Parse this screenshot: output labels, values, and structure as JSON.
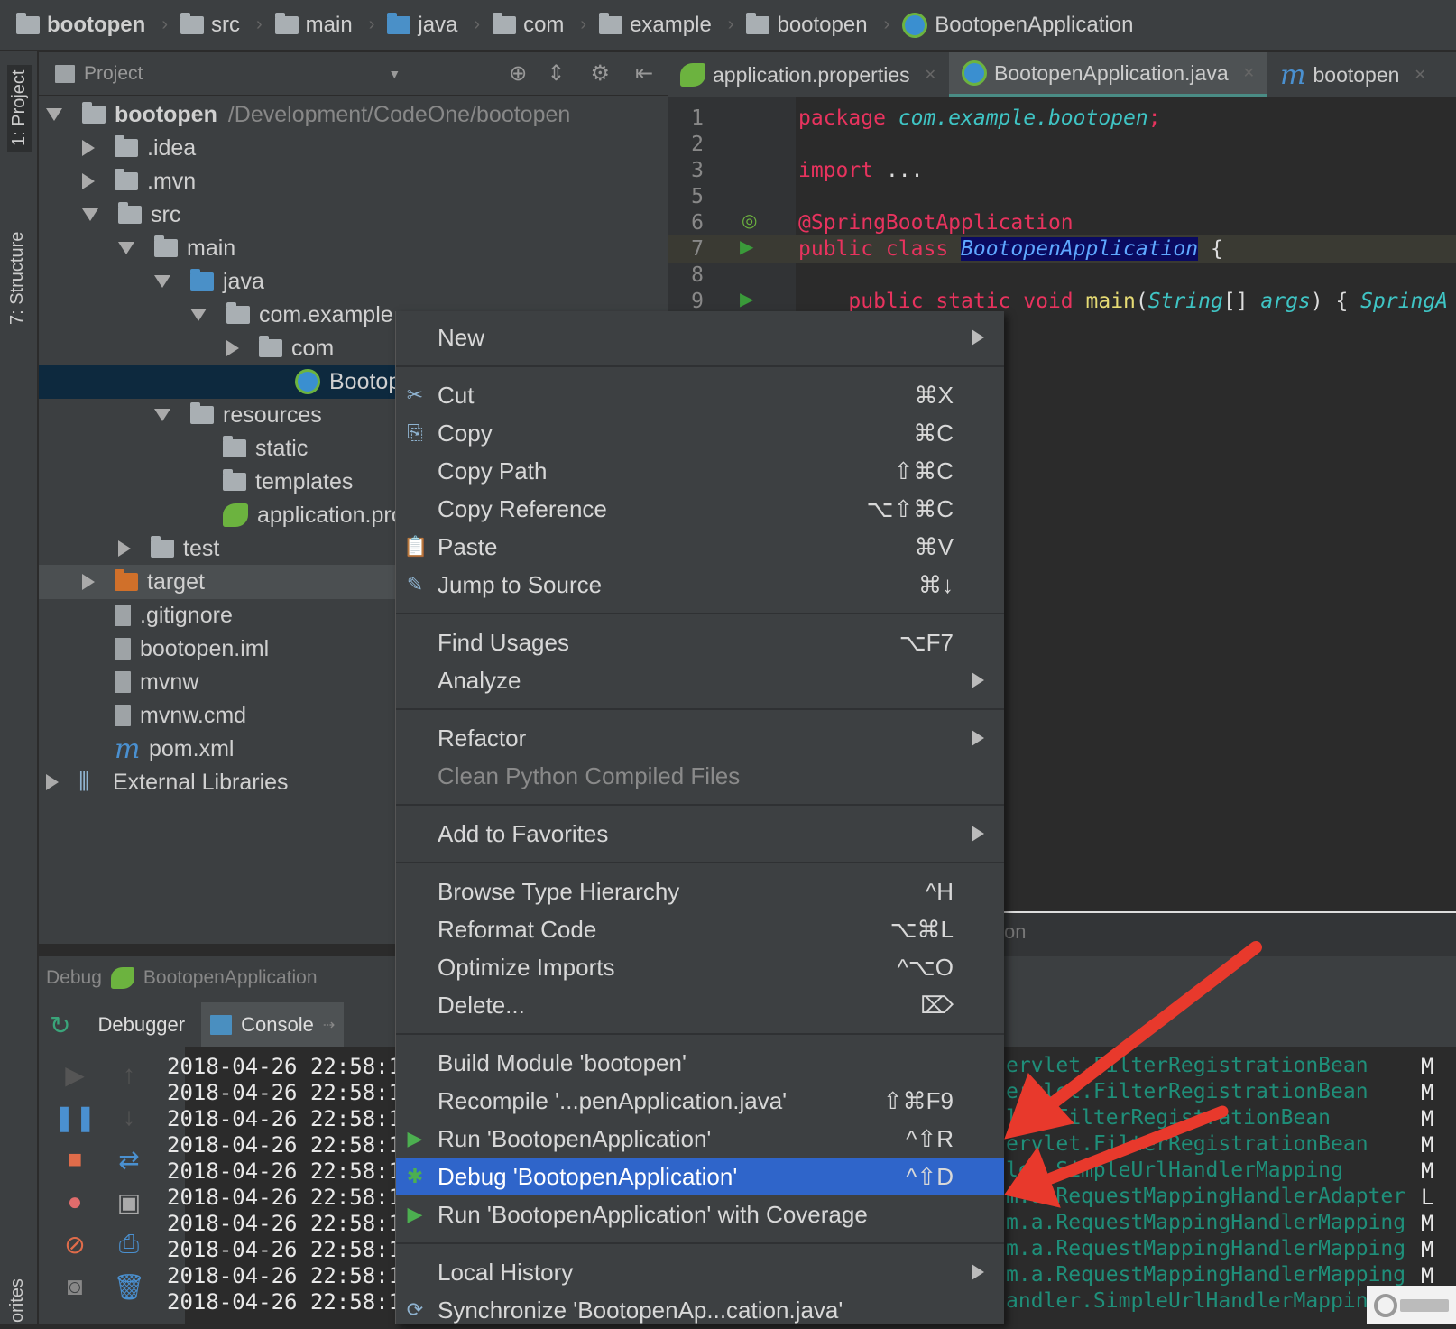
{
  "breadcrumb": [
    "bootopen",
    "src",
    "main",
    "java",
    "com",
    "example",
    "bootopen",
    "BootopenApplication"
  ],
  "toolstrip": {
    "project": "1: Project",
    "structure": "7: Structure",
    "favorites": "orites"
  },
  "project_panel": {
    "title": "Project"
  },
  "tree": [
    {
      "label": "bootopen",
      "path": "/Development/CodeOne/bootopen",
      "level": 0,
      "arrow": "open",
      "icon": "module-folder-icon"
    },
    {
      "label": ".idea",
      "level": 1,
      "arrow": "closed",
      "icon": "folder-icon"
    },
    {
      "label": ".mvn",
      "level": 1,
      "arrow": "closed",
      "icon": "folder-icon"
    },
    {
      "label": "src",
      "level": 1,
      "arrow": "open",
      "icon": "folder-icon"
    },
    {
      "label": "main",
      "level": 2,
      "arrow": "open",
      "icon": "folder-icon"
    },
    {
      "label": "java",
      "level": 3,
      "arrow": "open",
      "icon": "source-folder-icon"
    },
    {
      "label": "com.example",
      "level": 4,
      "arrow": "open",
      "icon": "package-icon"
    },
    {
      "label": "com",
      "level": 5,
      "arrow": "closed",
      "icon": "package-icon"
    },
    {
      "label": "BootopenApplication",
      "level": 6,
      "arrow": "none",
      "icon": "spring-boot-class-icon",
      "state": "selected"
    },
    {
      "label": "resources",
      "level": 3,
      "arrow": "open",
      "icon": "resources-folder-icon"
    },
    {
      "label": "static",
      "level": 4,
      "arrow": "none",
      "icon": "folder-icon"
    },
    {
      "label": "templates",
      "level": 4,
      "arrow": "none",
      "icon": "folder-icon"
    },
    {
      "label": "application.properties",
      "level": 4,
      "arrow": "none",
      "icon": "spring-properties-icon"
    },
    {
      "label": "test",
      "level": 2,
      "arrow": "closed",
      "icon": "folder-icon"
    },
    {
      "label": "target",
      "level": 1,
      "arrow": "closed",
      "icon": "excluded-folder-icon",
      "state": "hover"
    },
    {
      "label": ".gitignore",
      "level": 1,
      "arrow": "none",
      "icon": "file-icon"
    },
    {
      "label": "bootopen.iml",
      "level": 1,
      "arrow": "none",
      "icon": "iml-file-icon"
    },
    {
      "label": "mvnw",
      "level": 1,
      "arrow": "none",
      "icon": "file-icon"
    },
    {
      "label": "mvnw.cmd",
      "level": 1,
      "arrow": "none",
      "icon": "file-icon"
    },
    {
      "label": "pom.xml",
      "level": 1,
      "arrow": "none",
      "icon": "maven-icon"
    },
    {
      "label": "External Libraries",
      "level": 0,
      "arrow": "closed",
      "icon": "libraries-icon"
    }
  ],
  "editor": {
    "tabs": [
      {
        "label": "application.properties",
        "active": false
      },
      {
        "label": "BootopenApplication.java",
        "active": true
      },
      {
        "label": "bootopen",
        "active": false
      }
    ],
    "lines": [
      {
        "n": "1",
        "parts": [
          [
            "kw",
            "package "
          ],
          [
            "pk",
            "com.example.bootopen"
          ],
          [
            "kw",
            ";"
          ]
        ]
      },
      {
        "n": "2",
        "parts": []
      },
      {
        "n": "3",
        "parts": [
          [
            "kw",
            "import "
          ],
          [
            "plain",
            "..."
          ]
        ]
      },
      {
        "n": "5",
        "parts": []
      },
      {
        "n": "6",
        "parts": [
          [
            "ann",
            "@SpringBootApplication"
          ]
        ]
      },
      {
        "n": "7",
        "parts": [
          [
            "kw",
            "public class "
          ],
          [
            "cls",
            "BootopenApplication"
          ],
          [
            "plain",
            " {"
          ]
        ]
      },
      {
        "n": "8",
        "parts": []
      },
      {
        "n": "9",
        "parts": [
          [
            "kw",
            "    public static void "
          ],
          [
            "fn",
            "main"
          ],
          [
            "plain",
            "("
          ],
          [
            "pk",
            "String"
          ],
          [
            "plain",
            "[] "
          ],
          [
            "pk",
            "args"
          ],
          [
            "plain",
            ") { "
          ],
          [
            "pk",
            "SpringA"
          ]
        ]
      }
    ]
  },
  "context_menu": [
    {
      "label": "New",
      "submenu": true
    },
    {
      "sep": true
    },
    {
      "label": "Cut",
      "shortcut": "⌘X",
      "icon": "scissors-icon",
      "glyph": "✂"
    },
    {
      "label": "Copy",
      "shortcut": "⌘C",
      "icon": "copy-icon",
      "glyph": "⎘"
    },
    {
      "label": "Copy Path",
      "shortcut": "⇧⌘C"
    },
    {
      "label": "Copy Reference",
      "shortcut": "⌥⇧⌘C"
    },
    {
      "label": "Paste",
      "shortcut": "⌘V",
      "icon": "paste-icon",
      "glyph": "📋"
    },
    {
      "label": "Jump to Source",
      "shortcut": "⌘↓",
      "icon": "edit-icon",
      "glyph": "✎"
    },
    {
      "sep": true
    },
    {
      "label": "Find Usages",
      "shortcut": "⌥F7"
    },
    {
      "label": "Analyze",
      "submenu": true
    },
    {
      "sep": true
    },
    {
      "label": "Refactor",
      "submenu": true
    },
    {
      "label": "Clean Python Compiled Files",
      "disabled": true
    },
    {
      "sep": true
    },
    {
      "label": "Add to Favorites",
      "submenu": true
    },
    {
      "sep": true
    },
    {
      "label": "Browse Type Hierarchy",
      "shortcut": "^H"
    },
    {
      "label": "Reformat Code",
      "shortcut": "⌥⌘L"
    },
    {
      "label": "Optimize Imports",
      "shortcut": "^⌥O"
    },
    {
      "label": "Delete...",
      "shortcut": "⌦"
    },
    {
      "sep": true
    },
    {
      "label": "Build Module 'bootopen'"
    },
    {
      "label": "Recompile '...penApplication.java'",
      "shortcut": "⇧⌘F9"
    },
    {
      "label": "Run 'BootopenApplication'",
      "shortcut": "^⇧R",
      "icon": "run-icon",
      "glyph": "▶"
    },
    {
      "label": "Debug 'BootopenApplication'",
      "shortcut": "^⇧D",
      "icon": "debug-icon",
      "glyph": "✱",
      "active": true
    },
    {
      "label": "Run 'BootopenApplication' with Coverage",
      "icon": "coverage-icon",
      "glyph": "▶"
    },
    {
      "sep": true
    },
    {
      "label": "Local History",
      "submenu": true
    },
    {
      "label": "Synchronize 'BootopenAp...cation.java'",
      "icon": "sync-icon",
      "glyph": "⟳"
    }
  ],
  "debug_panel": {
    "title": "Debug",
    "config": "BootopenApplication",
    "tabs": {
      "debugger": "Debugger",
      "console": "Console"
    },
    "partial_label": "on"
  },
  "console": {
    "lines": [
      {
        "time": "2018-04-26 22:58:1",
        "logger": "ervlet.FilterRegistrationBean",
        "level": "M"
      },
      {
        "time": "2018-04-26 22:58:1",
        "logger": "ervlet.FilterRegistrationBean",
        "level": "M"
      },
      {
        "time": "2018-04-26 22:58:1",
        "logger": "let.FilterRegistrationBean",
        "level": "M"
      },
      {
        "time": "2018-04-26 22:58:1",
        "logger": "ervlet.FilterRegistrationBean",
        "level": "M"
      },
      {
        "time": "2018-04-26 22:58:1",
        "logger": "ler.SimpleUrlHandlerMapping",
        "level": "M"
      },
      {
        "time": "2018-04-26 22:58:1",
        "logger": "m.a.RequestMappingHandlerAdapter",
        "level": "L"
      },
      {
        "time": "2018-04-26 22:58:1",
        "logger": "m.a.RequestMappingHandlerMapping",
        "level": "M"
      },
      {
        "time": "2018-04-26 22:58:1",
        "logger": "m.a.RequestMappingHandlerMapping",
        "level": "M"
      },
      {
        "time": "2018-04-26 22:58:1",
        "logger": "m.a.RequestMappingHandlerMapping",
        "level": "M"
      },
      {
        "time": "2018-04-26 22:58:1",
        "logger": "andler.SimpleUrlHandlerMapping",
        "level": "M"
      }
    ]
  },
  "annotation_color": "#e8392c",
  "watermark": "创新互联"
}
